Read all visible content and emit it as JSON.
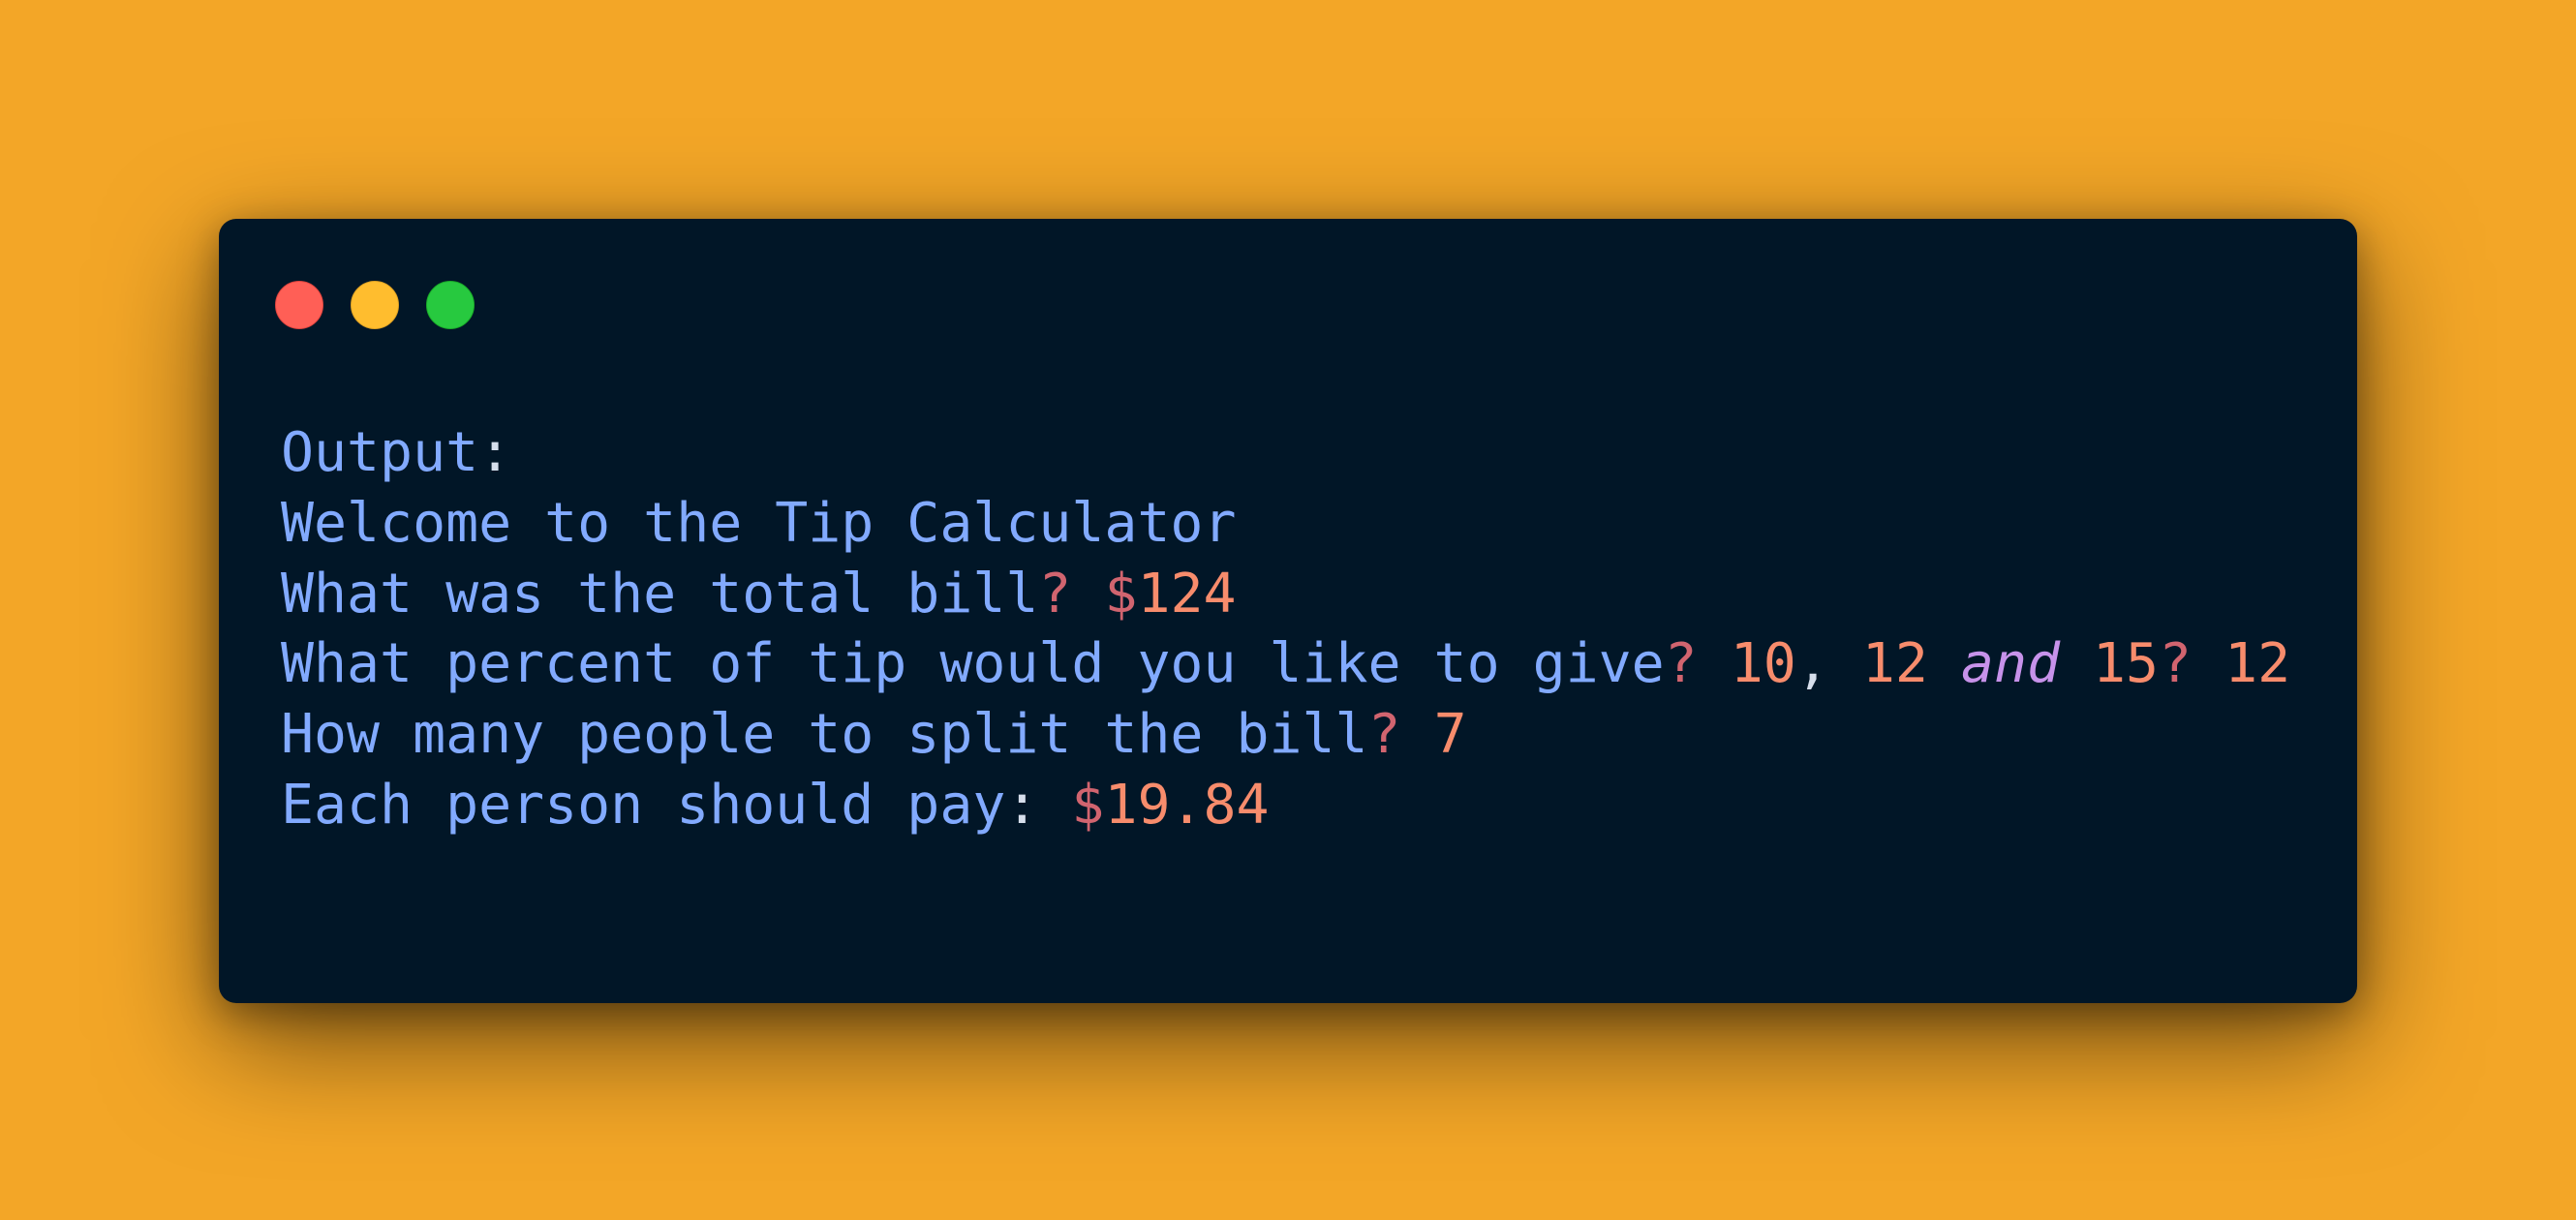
{
  "window": {
    "controls": {
      "close_color": "#ff5f56",
      "minimize_color": "#ffbd2e",
      "zoom_color": "#27c93f"
    }
  },
  "terminal": {
    "line1": {
      "text": "Output",
      "colon": ":"
    },
    "line2": {
      "text": "Welcome to the Tip Calculator"
    },
    "line3": {
      "text": "What was the total bill",
      "q": "?",
      "dollar": "$",
      "value": "124"
    },
    "line4": {
      "text": "What percent of tip would you like to give",
      "q1": "?",
      "v1": "10",
      "comma": ",",
      "v2": "12",
      "and": "and",
      "v3": "15",
      "q2": "?",
      "answer": "12"
    },
    "line5": {
      "text": "How many people to split the bill",
      "q": "?",
      "value": "7"
    },
    "line6": {
      "text": "Each person should pay",
      "colon": ":",
      "dollar": "$",
      "value": "19.84"
    }
  },
  "colors": {
    "background": "#f3a627",
    "window": "#011627",
    "text": "#82aaff",
    "punctuation": "#d1646f",
    "number": "#f78c6c",
    "keyword": "#c792ea"
  }
}
